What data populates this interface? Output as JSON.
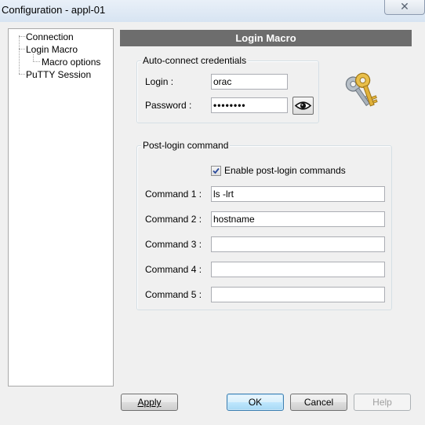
{
  "window": {
    "title": "Configuration - appl-01",
    "close_glyph": "✕"
  },
  "tree": {
    "items": [
      {
        "label": "Connection"
      },
      {
        "label": "Login Macro"
      },
      {
        "label": "Macro options"
      },
      {
        "label": "PuTTY Session"
      }
    ]
  },
  "panel": {
    "header": "Login Macro"
  },
  "credentials": {
    "group_label": "Auto-connect credentials",
    "login_label": "Login :",
    "login_value": "orac",
    "password_label": "Password :",
    "password_value": "••••••••",
    "reveal_icon": "eye-icon",
    "keys_icon": "keys-icon"
  },
  "postlogin": {
    "group_label": "Post-login command",
    "enable_label": "Enable post-login commands",
    "enable_checked": true,
    "commands": [
      {
        "label": "Command 1 :",
        "value": "ls -lrt"
      },
      {
        "label": "Command 2 :",
        "value": "hostname"
      },
      {
        "label": "Command 3 :",
        "value": ""
      },
      {
        "label": "Command 4 :",
        "value": ""
      },
      {
        "label": "Command 5 :",
        "value": ""
      }
    ]
  },
  "buttons": {
    "apply": "Apply",
    "ok": "OK",
    "cancel": "Cancel",
    "help": "Help"
  },
  "colors": {
    "header_bg": "#6d6d6d",
    "ok_border": "#3c7fb1",
    "key_gold": "#e3b23c",
    "key_gray": "#9aa3ad"
  }
}
